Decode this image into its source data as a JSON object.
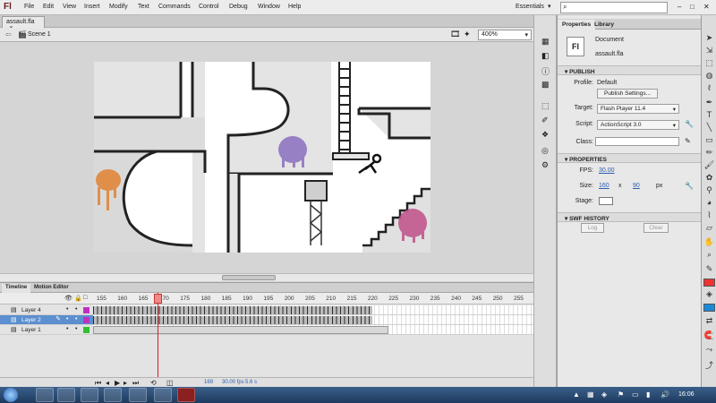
{
  "app": {
    "logo": "Fl",
    "workspace": "Essentials",
    "search_placeholder": ""
  },
  "menu": [
    "File",
    "Edit",
    "View",
    "Insert",
    "Modify",
    "Text",
    "Commands",
    "Control",
    "Debug",
    "Window",
    "Help"
  ],
  "window_controls": {
    "minimize": "–",
    "maximize": "□",
    "close": "✕"
  },
  "document": {
    "tab": "assault.fla",
    "scene": "Scene 1",
    "zoom": "400%"
  },
  "timeline": {
    "tabs": [
      "Timeline",
      "Motion Editor"
    ],
    "frame_numbers": [
      "155",
      "160",
      "165",
      "170",
      "175",
      "180",
      "185",
      "190",
      "195",
      "200",
      "205",
      "210",
      "215",
      "220",
      "225",
      "230",
      "235",
      "240",
      "245",
      "250",
      "255"
    ],
    "layers": [
      {
        "name": "Layer 4",
        "color": "#c030c0",
        "selected": false
      },
      {
        "name": "Layer 2",
        "color": "#c030c0",
        "selected": true
      },
      {
        "name": "Layer 1",
        "color": "#30c030",
        "selected": false
      }
    ],
    "footer": {
      "current_frame": "169",
      "fps": "30.00 fps",
      "time": "5.6 s"
    }
  },
  "properties": {
    "tabs": [
      "Properties",
      "Library"
    ],
    "doc_icon": "Fl",
    "doc_type": "Document",
    "doc_name": "assault.fla",
    "publish": {
      "header": "PUBLISH",
      "profile_label": "Profile:",
      "profile_value": "Default",
      "settings_button": "Publish Settings...",
      "target_label": "Target:",
      "target_value": "Flash Player 11.4",
      "script_label": "Script:",
      "script_value": "ActionScript 3.0",
      "class_label": "Class:"
    },
    "props": {
      "header": "PROPERTIES",
      "fps_label": "FPS:",
      "fps_value": "30.00",
      "size_label": "Size:",
      "width": "160",
      "x": "x",
      "height": "90",
      "unit": "px",
      "stage_label": "Stage:"
    },
    "swf_history": {
      "header": "SWF HISTORY",
      "log_button": "Log",
      "clear_button": "Clear"
    }
  },
  "taskbar": {
    "clock": "16:06"
  },
  "colors": {
    "accent": "#5b8fcf",
    "graffiti_orange": "#e0883a",
    "graffiti_purple": "#8a6fbf",
    "graffiti_pink": "#c0508a"
  }
}
